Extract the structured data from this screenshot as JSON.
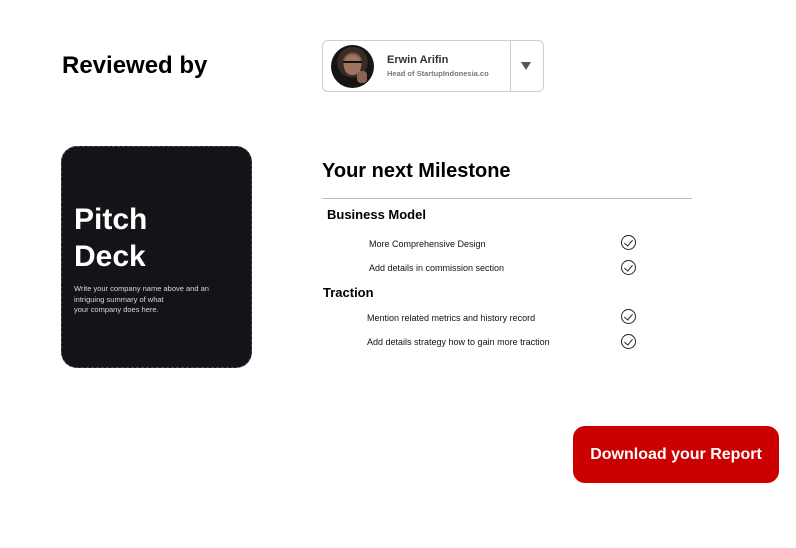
{
  "review": {
    "label": "Reviewed by",
    "reviewer": {
      "name": "Erwin Arifin",
      "role": "Head of StartupIndonesia.co"
    },
    "dropdown_icon": "chevron-down-icon"
  },
  "deck_card": {
    "title_line1": "Pitch",
    "title_line2": "Deck",
    "description_line1": "Write your company name above and an",
    "description_line2": "intriguing summary of what",
    "description_line3": "your company does here."
  },
  "milestone": {
    "title": "Your next Milestone",
    "sections": [
      {
        "heading": "Business Model",
        "items": [
          {
            "text": "More Comprehensive Design",
            "icon": "check-circle-icon"
          },
          {
            "text": "Add details in commission section",
            "icon": "check-circle-icon"
          }
        ]
      },
      {
        "heading": "Traction",
        "items": [
          {
            "text": "Mention related metrics and history record",
            "icon": "check-circle-icon"
          },
          {
            "text": "Add details strategy how to gain more traction",
            "icon": "check-circle-icon"
          }
        ]
      }
    ]
  },
  "actions": {
    "download_label": "Download your Report"
  },
  "colors": {
    "accent": "#cc0000",
    "card_bg": "#141418"
  }
}
